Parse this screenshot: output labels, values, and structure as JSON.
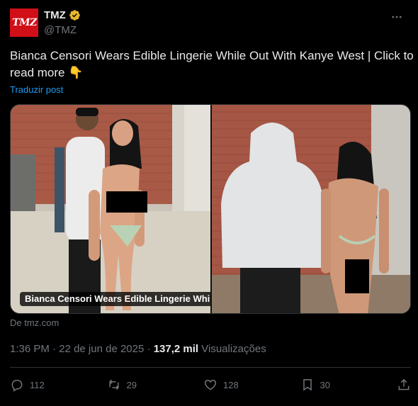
{
  "author": {
    "avatar_text": "TMZ",
    "display_name": "TMZ",
    "handle": "@TMZ",
    "verified_color": "#e8b828",
    "avatar_color": "#d10f18"
  },
  "post": {
    "text": "Bianca Censori Wears Edible Lingerie While Out With Kanye West   | Click to read more 👇",
    "translate_label": "Traduzir post"
  },
  "media": {
    "caption": "Bianca Censori Wears Edible Lingerie While Out With Kanye West",
    "source": "De tmz.com"
  },
  "meta": {
    "time": "1:36 PM",
    "separator": "·",
    "date": "22 de jun de 2025",
    "views_count": "137,2 mil",
    "views_label": "Visualizações"
  },
  "actions": {
    "replies": "112",
    "reposts": "29",
    "likes": "128",
    "bookmarks": "30",
    "icons": [
      "reply-icon",
      "repost-icon",
      "like-icon",
      "bookmark-icon",
      "share-icon"
    ]
  },
  "colors": {
    "background": "#000000",
    "text": "#e7e9ea",
    "muted": "#71767b",
    "link": "#1d9bf0",
    "border": "#2f3336"
  }
}
